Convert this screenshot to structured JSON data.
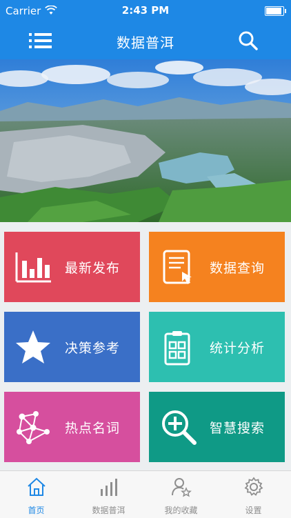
{
  "status_bar": {
    "carrier": "Carrier",
    "time": "2:43 PM"
  },
  "nav": {
    "title": "数据普洱"
  },
  "tiles": [
    {
      "label": "最新发布",
      "color": "#e0485b"
    },
    {
      "label": "数据查询",
      "color": "#f5821f"
    },
    {
      "label": "决策参考",
      "color": "#3a6fc7"
    },
    {
      "label": "统计分析",
      "color": "#2dbfb0"
    },
    {
      "label": "热点名词",
      "color": "#d64f9e"
    },
    {
      "label": "智慧搜索",
      "color": "#0f9a86"
    }
  ],
  "tabs": [
    {
      "label": "首页",
      "active": true
    },
    {
      "label": "数据普洱",
      "active": false
    },
    {
      "label": "我的收藏",
      "active": false
    },
    {
      "label": "设置",
      "active": false
    }
  ],
  "colors": {
    "primary": "#1e88e5",
    "inactive": "#8e8e8e"
  }
}
